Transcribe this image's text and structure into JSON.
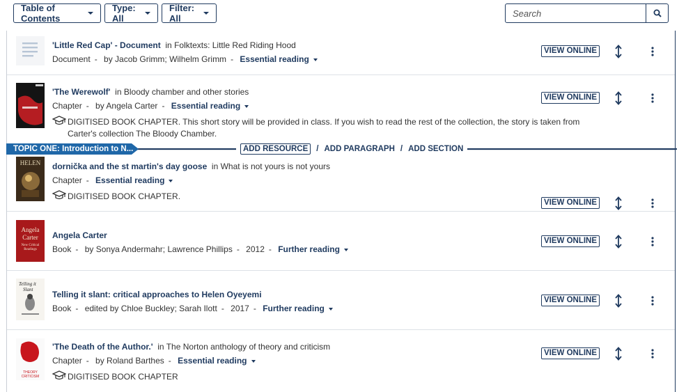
{
  "toolbar": {
    "toc_label": "Table of Contents",
    "type_label": "Type: All",
    "filter_label": "Filter: All",
    "search_placeholder": "Search"
  },
  "topic": {
    "label": "TOPIC ONE: Introduction to N...",
    "add_resource": "ADD RESOURCE",
    "add_paragraph": "ADD PARAGRAPH",
    "add_section": "ADD SECTION",
    "sep": "/"
  },
  "view_online_label": "VIEW ONLINE",
  "items": [
    {
      "title": "'Little Red Cap' - Document",
      "in": "in Folktexts: Little Red Riding Hood",
      "type": "Document",
      "authors": "by Jacob Grimm; Wilhelm Grimm",
      "year": "",
      "status": "Essential reading",
      "note": ""
    },
    {
      "title": "'The Werewolf'",
      "in": "in Bloody chamber and other stories",
      "type": "Chapter",
      "authors": "by Angela Carter",
      "year": "",
      "status": "Essential reading",
      "note": "DIGITISED BOOK CHAPTER. This short story will be provided in class. If you wish to read the rest of the collection, the story is taken from Carter's collection The Bloody Chamber."
    },
    {
      "title": "dornička and the st martin's day goose",
      "in": "in What is not yours is not yours",
      "type": "Chapter",
      "authors": "",
      "year": "",
      "status": "Essential reading",
      "note": "DIGITISED BOOK CHAPTER."
    },
    {
      "title": "Angela Carter",
      "in": "",
      "type": "Book",
      "authors": "by Sonya Andermahr; Lawrence Phillips",
      "year": "2012",
      "status": "Further reading",
      "note": ""
    },
    {
      "title": "Telling it slant: critical approaches to Helen Oyeyemi",
      "in": "",
      "type": "Book",
      "authors": "edited by Chloe Buckley; Sarah Ilott",
      "year": "2017",
      "status": "Further reading",
      "note": ""
    },
    {
      "title": "'The Death of the Author.'",
      "in": "in The Norton anthology of theory and criticism",
      "type": "Chapter",
      "authors": "by Roland Barthes",
      "year": "",
      "status": "Essential reading",
      "note": "DIGITISED BOOK CHAPTER"
    }
  ],
  "cover_text": {
    "angela_carter": "Angela Carter",
    "new_critical": "New Critical Readings",
    "telling": "Telling it Slant",
    "helen": "HELEN",
    "norton": "THEORY CRITICISM"
  },
  "colors": {
    "accent": "#1f3a5f",
    "topic_bar": "#1f67a8"
  }
}
